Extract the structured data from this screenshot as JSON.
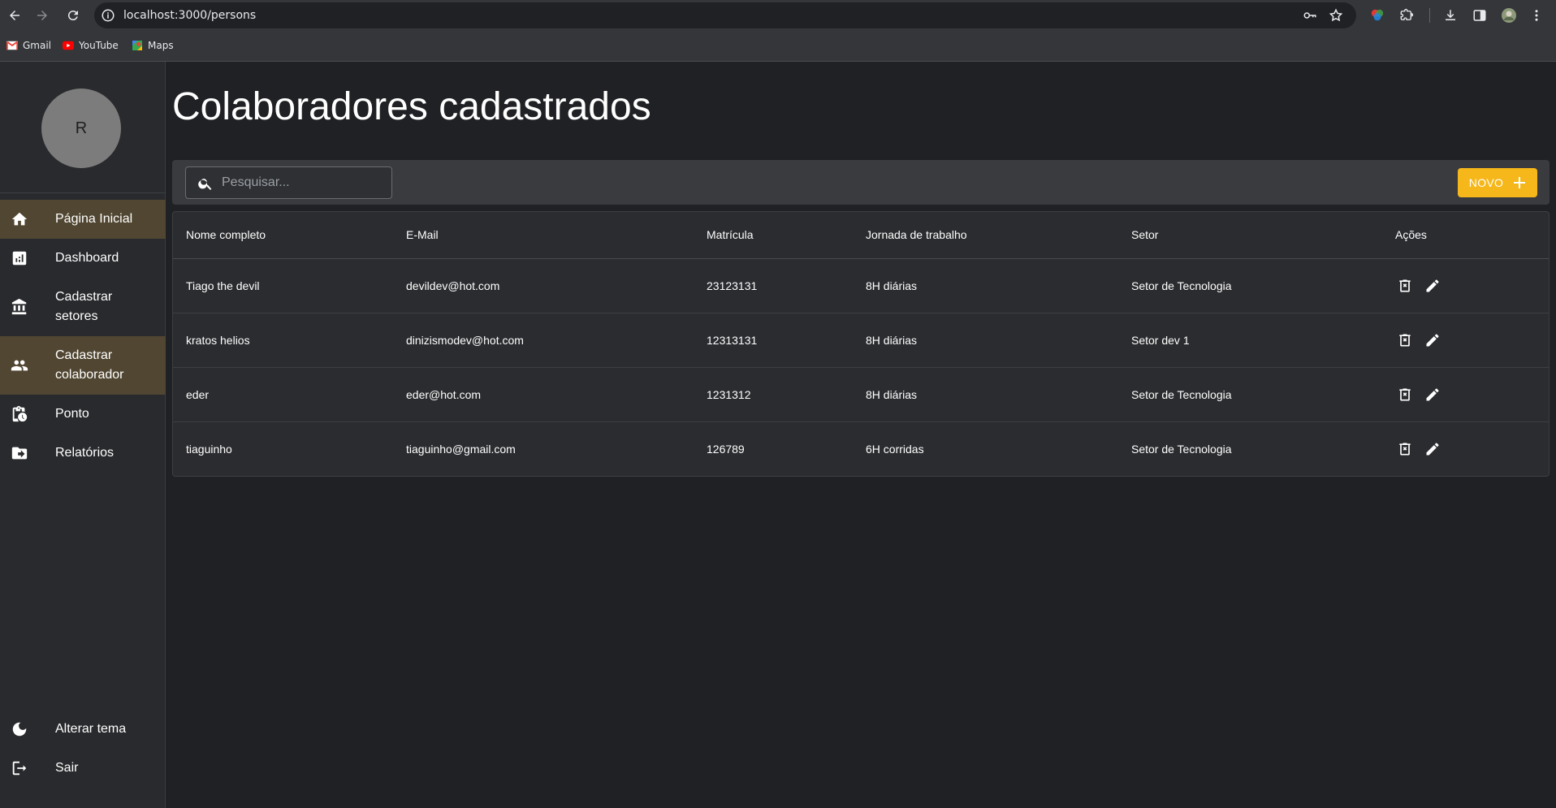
{
  "browser": {
    "url": "localhost:3000/persons",
    "bookmarks": [
      {
        "label": "Gmail",
        "icon": "gmail-icon"
      },
      {
        "label": "YouTube",
        "icon": "youtube-icon"
      },
      {
        "label": "Maps",
        "icon": "maps-icon"
      }
    ]
  },
  "sidebar": {
    "avatar_initial": "R",
    "items": [
      {
        "label": "Página Inicial",
        "icon": "home-icon"
      },
      {
        "label": "Dashboard",
        "icon": "chart-icon"
      },
      {
        "label": "Cadastrar setores",
        "icon": "bank-icon"
      },
      {
        "label": "Cadastrar colaborador",
        "icon": "people-icon"
      },
      {
        "label": "Ponto",
        "icon": "clipboard-clock-icon"
      },
      {
        "label": "Relatórios",
        "icon": "folder-export-icon"
      }
    ],
    "bottom": [
      {
        "label": "Alterar tema",
        "icon": "moon-icon"
      },
      {
        "label": "Sair",
        "icon": "logout-icon"
      }
    ]
  },
  "page": {
    "title": "Colaboradores cadastrados"
  },
  "toolbar": {
    "search_placeholder": "Pesquisar...",
    "new_label": "NOVO"
  },
  "table": {
    "headers": [
      "Nome completo",
      "E-Mail",
      "Matrícula",
      "Jornada de trabalho",
      "Setor",
      "Ações"
    ],
    "rows": [
      [
        "Tiago the devil",
        "devildev@hot.com",
        "23123131",
        "8H diárias",
        "Setor de Tecnologia"
      ],
      [
        "kratos helios",
        "dinizismodev@hot.com",
        "12313131",
        "8H diárias",
        "Setor dev 1"
      ],
      [
        "eder",
        "eder@hot.com",
        "1231312",
        "8H diárias",
        "Setor de Tecnologia"
      ],
      [
        "tiaguinho",
        "tiaguinho@gmail.com",
        "126789",
        "6H corridas",
        "Setor de Tecnologia"
      ]
    ]
  },
  "colors": {
    "accent": "#f5b71a",
    "active_item": "#514631",
    "background": "#202124"
  }
}
